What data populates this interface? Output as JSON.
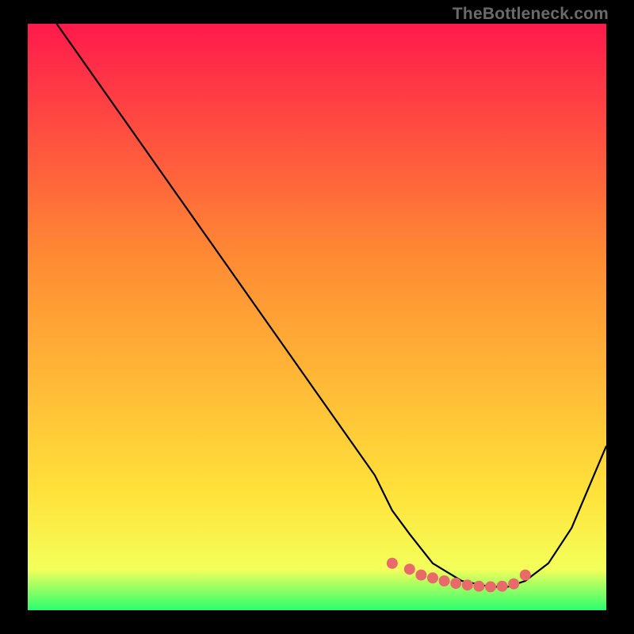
{
  "watermark": "TheBottleneck.com",
  "chart_data": {
    "type": "line",
    "title": "",
    "xlabel": "",
    "ylabel": "",
    "xlim": [
      0,
      100
    ],
    "ylim": [
      0,
      100
    ],
    "gradient": {
      "top": "#ff1a4c",
      "mid_upper": "#ff8b33",
      "mid_lower": "#ffe23a",
      "bottom": "#2aff6e"
    },
    "series": [
      {
        "name": "bottleneck-curve",
        "color": "#000000",
        "x": [
          5,
          10,
          15,
          20,
          25,
          30,
          35,
          40,
          45,
          50,
          55,
          60,
          63,
          66,
          70,
          75,
          80,
          83,
          86,
          90,
          94,
          100
        ],
        "y": [
          100,
          93,
          86,
          79,
          72,
          65,
          58,
          51,
          44,
          37,
          30,
          23,
          17,
          13,
          8,
          5,
          4,
          4,
          5,
          8,
          14,
          28
        ]
      }
    ],
    "markers": {
      "name": "highlight-points",
      "color": "#e86a6a",
      "x": [
        63,
        66,
        68,
        70,
        72,
        74,
        76,
        78,
        80,
        82,
        84,
        86
      ],
      "y": [
        8,
        7,
        6,
        5.5,
        5,
        4.6,
        4.3,
        4.1,
        4,
        4.1,
        4.5,
        6
      ]
    }
  }
}
